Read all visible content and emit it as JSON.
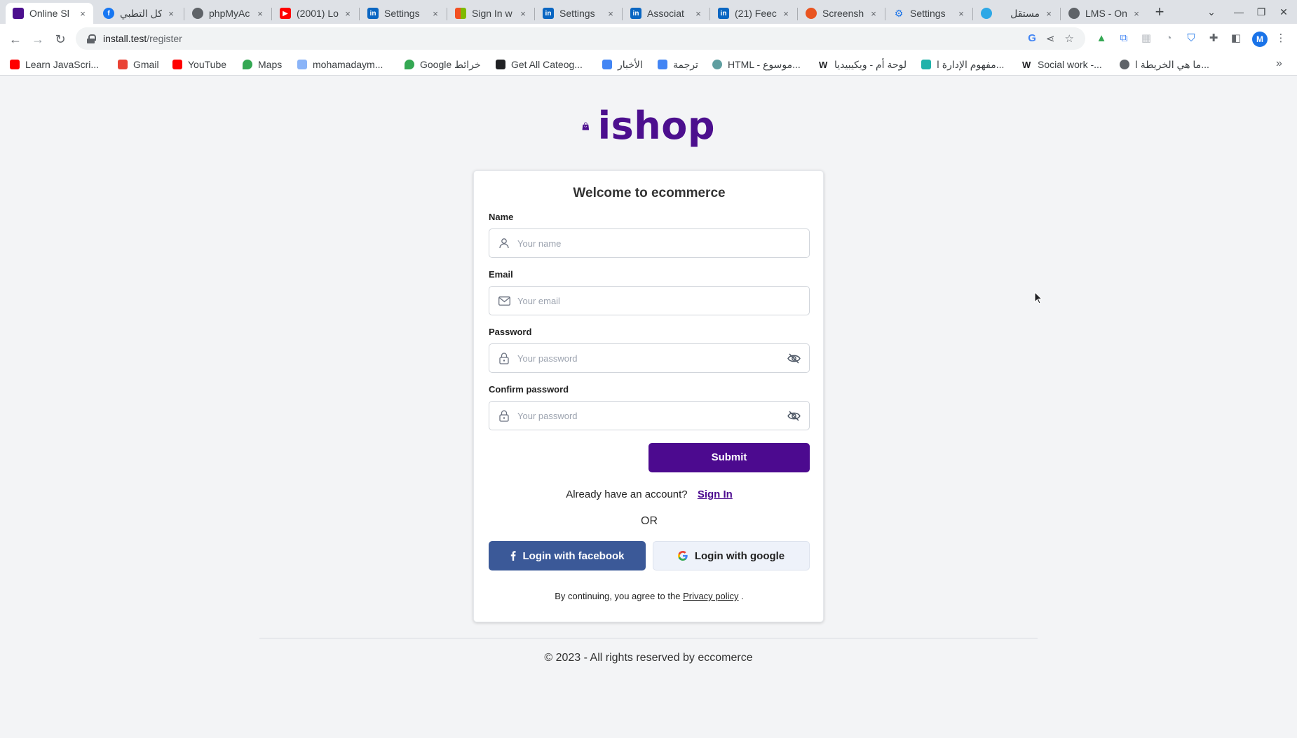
{
  "browser": {
    "tabs": [
      {
        "title": "Online Sl",
        "active": true,
        "favicon_color": "#4c0f8e",
        "icon": "bag-icon"
      },
      {
        "title": "كل التطبي",
        "active": false,
        "favicon_color": "#1877f2",
        "icon": "facebook-icon"
      },
      {
        "title": "phpMyAc",
        "active": false,
        "favicon_color": "#5f6368",
        "icon": "globe-icon"
      },
      {
        "title": "(2001) Lo",
        "active": false,
        "favicon_color": "#ff0000",
        "icon": "youtube-icon"
      },
      {
        "title": "Settings",
        "active": false,
        "favicon_color": "#0a66c2",
        "icon": "linkedin-icon"
      },
      {
        "title": "Sign In w",
        "active": false,
        "favicon_color": "#f25022",
        "icon": "microsoft-icon"
      },
      {
        "title": "Settings",
        "active": false,
        "favicon_color": "#0a66c2",
        "icon": "linkedin-icon"
      },
      {
        "title": "Associat",
        "active": false,
        "favicon_color": "#0a66c2",
        "icon": "linkedin-icon"
      },
      {
        "title": "(21) Feec",
        "active": false,
        "favicon_color": "#0a66c2",
        "icon": "linkedin-icon"
      },
      {
        "title": "Screensh",
        "active": false,
        "favicon_color": "#e95420",
        "icon": "ubuntu-icon"
      },
      {
        "title": "Settings",
        "active": false,
        "favicon_color": "#1a73e8",
        "icon": "gear-icon"
      },
      {
        "title": "مستقل",
        "active": false,
        "favicon_color": "#2ea8e6",
        "icon": "circle-icon"
      },
      {
        "title": "LMS - On",
        "active": false,
        "favicon_color": "#5f6368",
        "icon": "globe-icon"
      }
    ],
    "tab_close": "×",
    "new_tab": "+",
    "window": {
      "list": "⌄",
      "minimize": "—",
      "restore": "❐",
      "close": "✕"
    },
    "nav": {
      "back": "←",
      "forward": "→",
      "reload": "↻"
    },
    "url_host": "install.test",
    "url_path": "/register",
    "profile_initial": "M",
    "bookmarks": [
      {
        "label": "Learn JavaScri...",
        "color": "#ff0000"
      },
      {
        "label": "Gmail",
        "color": "#ea4335"
      },
      {
        "label": "YouTube",
        "color": "#ff0000"
      },
      {
        "label": "Maps",
        "color": "#34a853"
      },
      {
        "label": "mohamadaym...",
        "color": "#8ab4f8"
      },
      {
        "label": "Google خرائط",
        "color": "#34a853"
      },
      {
        "label": "Get All Cateog...",
        "color": "#202124"
      },
      {
        "label": "الأخبار",
        "color": "#4285f4"
      },
      {
        "label": "ترجمة",
        "color": "#4285f4"
      },
      {
        "label": "HTML - موسوع...",
        "color": "#5f9ea0"
      },
      {
        "label": "لوحة أم - ويكيبيديا",
        "color": "#202124"
      },
      {
        "label": "مفهوم الإدارة ا...",
        "color": "#20b2aa"
      },
      {
        "label": "Social work -...",
        "color": "#202124"
      },
      {
        "label": "ما هي الخريطة ا...",
        "color": "#5f6368"
      }
    ],
    "bookmarks_more": "»"
  },
  "page": {
    "brand": "ishop",
    "brand_color": "#4c0f8e",
    "card_title": "Welcome to ecommerce",
    "fields": {
      "name": {
        "label": "Name",
        "placeholder": "Your name",
        "value": ""
      },
      "email": {
        "label": "Email",
        "placeholder": "Your email",
        "value": ""
      },
      "password": {
        "label": "Password",
        "placeholder": "Your password",
        "value": ""
      },
      "confirm": {
        "label": "Confirm password",
        "placeholder": "Your password",
        "value": ""
      }
    },
    "submit_label": "Submit",
    "already_text": "Already have an account?",
    "sign_in_label": "Sign In",
    "or_text": "OR",
    "facebook_label": "Login with facebook",
    "google_label": "Login with google",
    "terms_prefix": "By continuing, you agree to the",
    "terms_link": "Privacy policy",
    "terms_suffix": ".",
    "footer": "© 2023 - All rights reserved by eccomerce"
  }
}
